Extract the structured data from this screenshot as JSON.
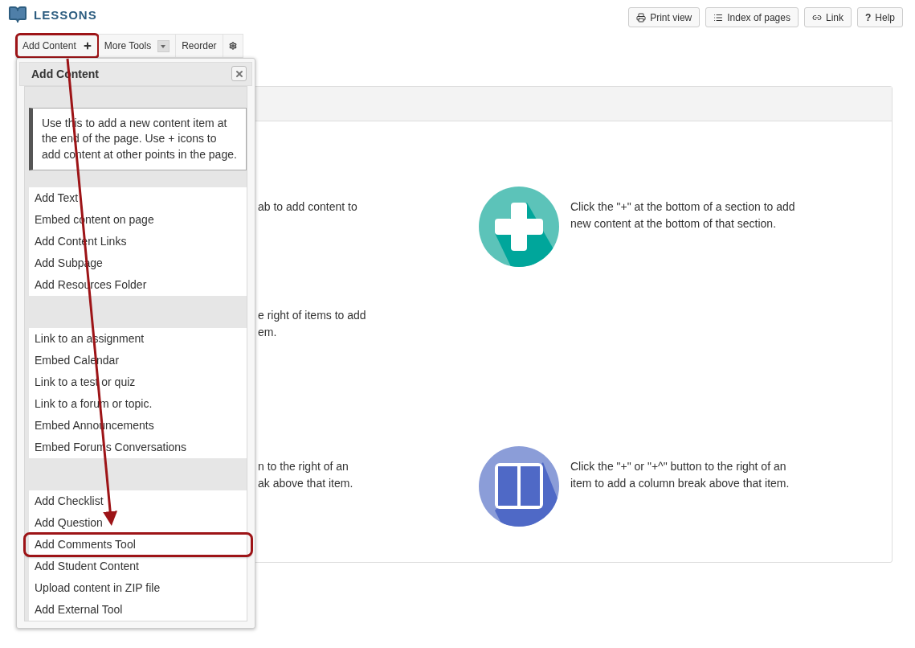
{
  "header": {
    "title": "LESSONS",
    "buttons": [
      {
        "label": "Print view",
        "kind": "print"
      },
      {
        "label": "Index of pages",
        "kind": "list"
      },
      {
        "label": "Link",
        "kind": "link"
      },
      {
        "label": "Help",
        "kind": "help",
        "icon_text": "?"
      }
    ]
  },
  "toolbar": {
    "items": [
      {
        "kind": "add",
        "label": "Add Content",
        "highlighted": true
      },
      {
        "kind": "dropdown",
        "label": "More Tools",
        "highlighted": false
      },
      {
        "kind": "text",
        "label": "Reorder",
        "highlighted": false
      },
      {
        "kind": "settings",
        "highlighted": false
      }
    ]
  },
  "content_panel": {
    "rows": [
      {
        "left_text": [
          "ab to add content to"
        ],
        "right": {
          "kind": "plus",
          "text": [
            "Click the \"+\" at the bottom of a section to add",
            "new content at the bottom of that section."
          ]
        }
      },
      {
        "left_text": [
          "e right of items to add",
          "em."
        ]
      },
      {
        "left_text": [
          "n to the right of an",
          "ak above that item."
        ],
        "right": {
          "kind": "columns",
          "text": [
            "Click the \"+\" or \"+^\" button to the right of an",
            "item to add a column break above that item."
          ]
        }
      }
    ]
  },
  "add_content_menu": {
    "title": "Add Content",
    "info": "Use this to add a new content item at the end of the page. Use + icons to add content at other points in the page.",
    "groups": [
      {
        "items": [
          {
            "label": "Add Text",
            "highlighted": false
          },
          {
            "label": "Embed content on page",
            "highlighted": false
          },
          {
            "label": "Add Content Links",
            "highlighted": false
          },
          {
            "label": "Add Subpage",
            "highlighted": false
          },
          {
            "label": "Add Resources Folder",
            "highlighted": false
          }
        ]
      },
      {
        "items": [
          {
            "label": "Link to an assignment",
            "highlighted": false
          },
          {
            "label": "Embed Calendar",
            "highlighted": false
          },
          {
            "label": "Link to a test or quiz",
            "highlighted": false
          },
          {
            "label": "Link to a forum or topic.",
            "highlighted": false
          },
          {
            "label": "Embed Announcements",
            "highlighted": false
          },
          {
            "label": "Embed Forums Conversations",
            "highlighted": false
          }
        ]
      },
      {
        "items": [
          {
            "label": "Add Checklist",
            "highlighted": false
          },
          {
            "label": "Add Question",
            "highlighted": false
          },
          {
            "label": "Add Comments Tool",
            "highlighted": true
          },
          {
            "label": "Add Student Content",
            "highlighted": false
          },
          {
            "label": "Upload content in ZIP file",
            "highlighted": false
          },
          {
            "label": "Add External Tool",
            "highlighted": false
          }
        ]
      }
    ]
  }
}
